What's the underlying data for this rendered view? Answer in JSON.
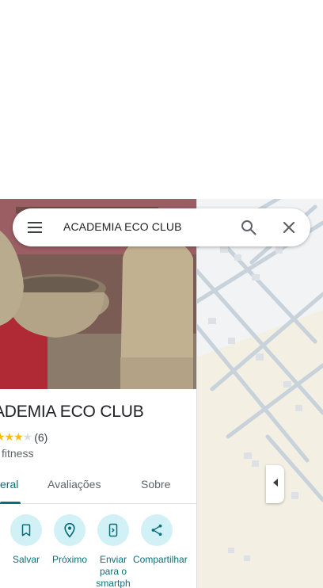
{
  "search": {
    "query": "ACADEMIA ECO CLUB"
  },
  "place": {
    "title": "ADEMIA ECO CLUB",
    "rating_count": "(6)",
    "rating": 3,
    "category": "fitness"
  },
  "tabs": [
    {
      "label": "eral",
      "active": true
    },
    {
      "label": "Avaliações",
      "active": false
    },
    {
      "label": "Sobre",
      "active": false
    }
  ],
  "actions": [
    {
      "label": "Salvar",
      "icon": "bookmark-icon"
    },
    {
      "label": "Próximo",
      "icon": "nearby-icon"
    },
    {
      "label": "Enviar para o smartph",
      "icon": "send-to-phone-icon"
    },
    {
      "label": "Compartilhar",
      "icon": "share-icon"
    }
  ],
  "colors": {
    "accent": "#0b6e77",
    "action_bg": "#d2f1f7",
    "star": "#fbbc04"
  }
}
